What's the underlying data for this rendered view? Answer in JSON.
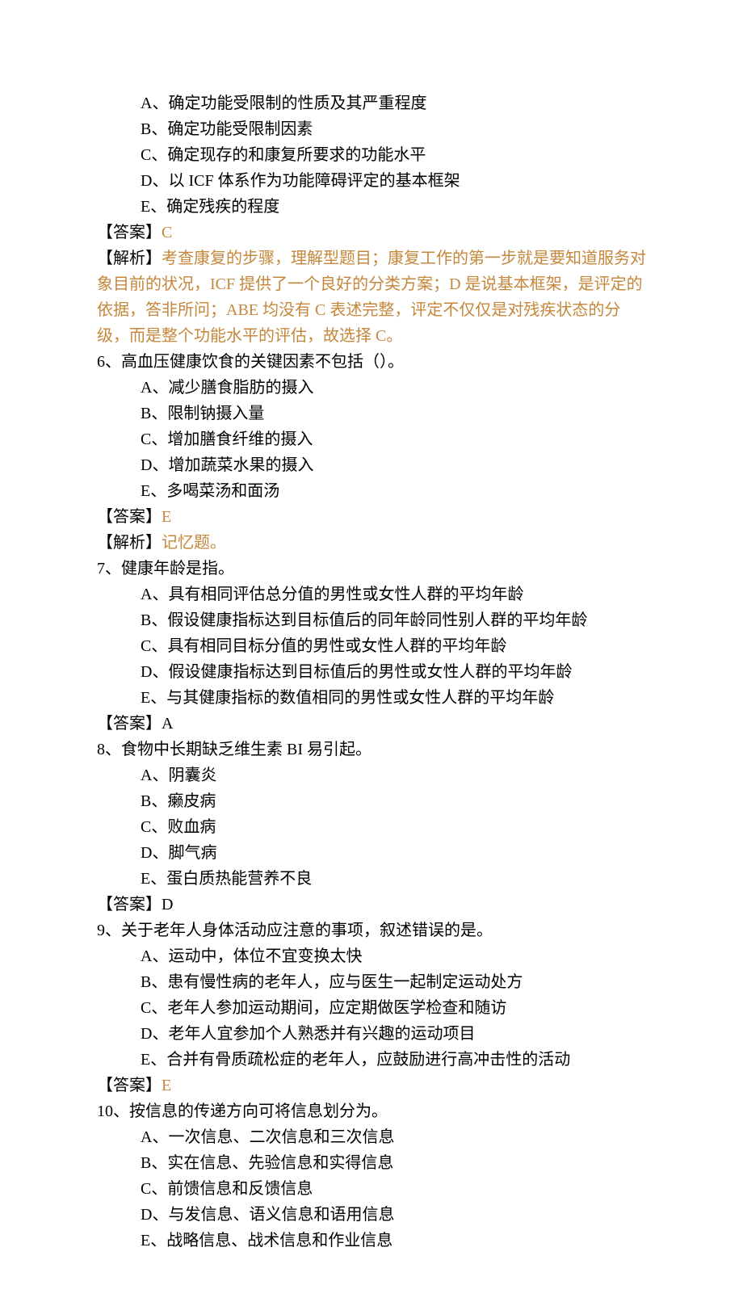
{
  "q5": {
    "options": {
      "A": "A、确定功能受限制的性质及其严重程度",
      "B": "B、确定功能受限制因素",
      "C": "C、确定现存的和康复所要求的功能水平",
      "D": "D、以 ICF 体系作为功能障碍评定的基本框架",
      "E": "E、确定残疾的程度"
    },
    "answer_label": "【答案】",
    "answer_value": "C",
    "explain_label": "【解析】",
    "explain_text": "考查康复的步骤，理解型题目；康复工作的第一步就是要知道服务对象目前的状况，ICF 提供了一个良好的分类方案；D 是说基本框架，是评定的依据，答非所问；ABE 均没有 C 表述完整，评定不仅仅是对残疾状态的分级，而是整个功能水平的评估，故选择 C。"
  },
  "q6": {
    "stem": "6、高血压健康饮食的关键因素不包括（）。",
    "options": {
      "A": "A、减少膳食脂肪的摄入",
      "B": "B、限制钠摄入量",
      "C": "C、增加膳食纤维的摄入",
      "D": "D、增加蔬菜水果的摄入",
      "E": "E、多喝菜汤和面汤"
    },
    "answer_label": "【答案】",
    "answer_value": "E",
    "explain_label": "【解析】",
    "explain_text": "记忆题。"
  },
  "q7": {
    "stem": "7、健康年龄是指。",
    "options": {
      "A": "A、具有相同评估总分值的男性或女性人群的平均年龄",
      "B": "B、假设健康指标达到目标值后的同年龄同性别人群的平均年龄",
      "C": "C、具有相同目标分值的男性或女性人群的平均年龄",
      "D": "D、假设健康指标达到目标值后的男性或女性人群的平均年龄",
      "E": "E、与其健康指标的数值相同的男性或女性人群的平均年龄"
    },
    "answer_label": "【答案】",
    "answer_value": "A"
  },
  "q8": {
    "stem": "8、食物中长期缺乏维生素 BI 易引起。",
    "options": {
      "A": "A、阴囊炎",
      "B": "B、癞皮病",
      "C": "C、败血病",
      "D": "D、脚气病",
      "E": "E、蛋白质热能营养不良"
    },
    "answer_label": "【答案】",
    "answer_value": "D"
  },
  "q9": {
    "stem": "9、关于老年人身体活动应注意的事项，叙述错误的是。",
    "options": {
      "A": "A、运动中，体位不宜变换太快",
      "B": "B、患有慢性病的老年人，应与医生一起制定运动处方",
      "C": "C、老年人参加运动期间，应定期做医学检查和随访",
      "D": "D、老年人宜参加个人熟悉并有兴趣的运动项目",
      "E": "E、合并有骨质疏松症的老年人，应鼓励进行高冲击性的活动"
    },
    "answer_label": "【答案】",
    "answer_value": "E"
  },
  "q10": {
    "stem": "10、按信息的传递方向可将信息划分为。",
    "options": {
      "A": "A、一次信息、二次信息和三次信息",
      "B": "B、实在信息、先验信息和实得信息",
      "C": "C、前馈信息和反馈信息",
      "D": "D、与发信息、语义信息和语用信息",
      "E": "E、战略信息、战术信息和作业信息"
    }
  }
}
